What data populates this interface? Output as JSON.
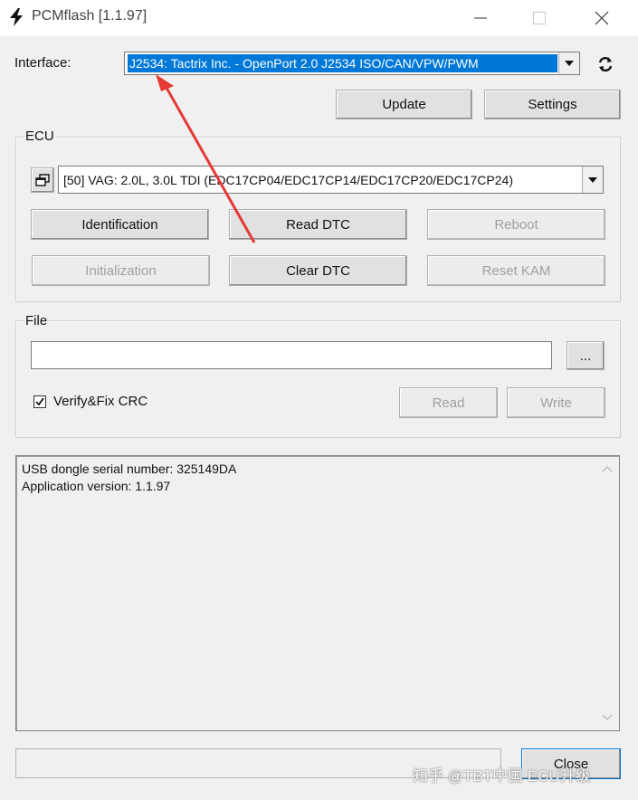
{
  "window": {
    "title": "PCMflash [1.1.97]",
    "minimize_glyph": "—",
    "close_glyph": "✕"
  },
  "interface": {
    "label": "Interface:",
    "selected": "J2534: Tactrix Inc. - OpenPort 2.0 J2534 ISO/CAN/VPW/PWM",
    "refresh_icon": "refresh-icon",
    "update_label": "Update",
    "settings_label": "Settings"
  },
  "ecu": {
    "group_title": "ECU",
    "selected": "[50] VAG: 2.0L, 3.0L TDI (EDC17CP04/EDC17CP14/EDC17CP20/EDC17CP24)",
    "buttons": {
      "identification": "Identification",
      "read_dtc": "Read DTC",
      "reboot": "Reboot",
      "initialization": "Initialization",
      "clear_dtc": "Clear DTC",
      "reset_kam": "Reset KAM"
    }
  },
  "file": {
    "group_title": "File",
    "path_value": "",
    "browse_label": "...",
    "verify_label": "Verify&Fix CRC",
    "verify_checked": true,
    "read_label": "Read",
    "write_label": "Write"
  },
  "log": {
    "lines": [
      "USB dongle serial number: 325149DA",
      "Application version: 1.1.97"
    ]
  },
  "footer": {
    "close_label": "Close"
  },
  "watermark": "知乎 @TBT中国 ECU升级",
  "colors": {
    "selection": "#0078d7",
    "annotation_arrow": "#e53935"
  }
}
